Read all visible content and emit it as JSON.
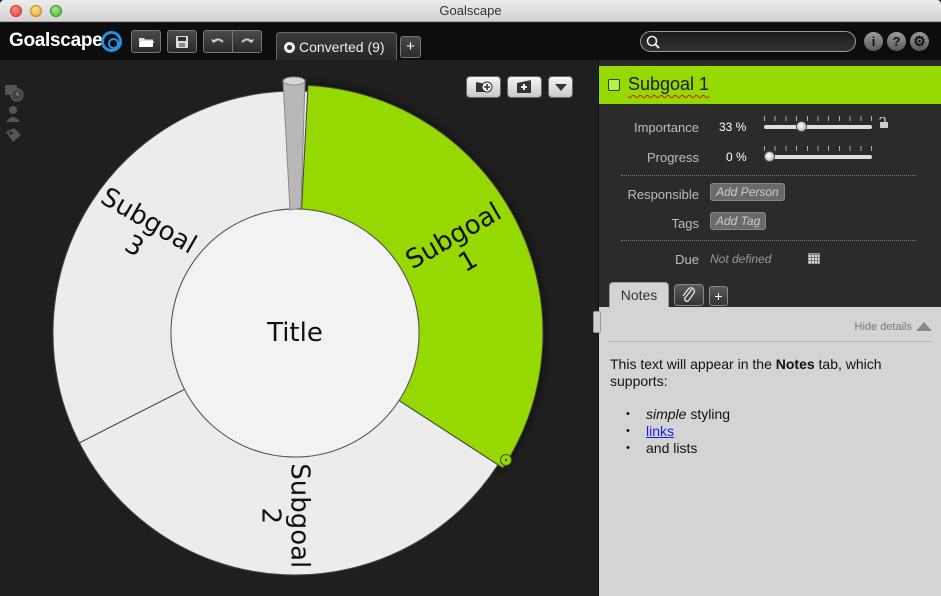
{
  "window": {
    "title": "Goalscape"
  },
  "toolbar": {
    "logo": "Goalscape",
    "tab_label": "Converted (9)",
    "add_tab": "+",
    "search_placeholder": "",
    "info": "i",
    "help": "?"
  },
  "colors": {
    "accent": "#95d900",
    "segment": "#ececec",
    "panel_bg": "#2b2b2b",
    "notes_bg": "#d4d4d4"
  },
  "goalmap": {
    "center": "Title",
    "segments": [
      {
        "line1": "Subgoal",
        "line2": "1",
        "selected": true,
        "share": 0.333
      },
      {
        "line1": "Subgoal",
        "line2": "2",
        "selected": false,
        "share": 0.333
      },
      {
        "line1": "Subgoal",
        "line2": "3",
        "selected": false,
        "share": 0.333
      }
    ]
  },
  "details": {
    "name": "Subgoal 1",
    "importance_label": "Importance",
    "importance_value": "33 %",
    "importance": 0.33,
    "progress_label": "Progress",
    "progress_value": "0 %",
    "progress": 0.0,
    "responsible_label": "Responsible",
    "responsible_chip": "Add Person",
    "tags_label": "Tags",
    "tags_chip": "Add Tag",
    "due_label": "Due",
    "due_value": "Not defined"
  },
  "notes": {
    "tab": "Notes",
    "add": "+",
    "hide": "Hide details",
    "intro_before": "This text will appear in the ",
    "intro_bold": "Notes",
    "intro_after": " tab, which supports:",
    "item1_em": "simple",
    "item1_rest": " styling",
    "item2_link": "links",
    "item3": "and lists"
  }
}
